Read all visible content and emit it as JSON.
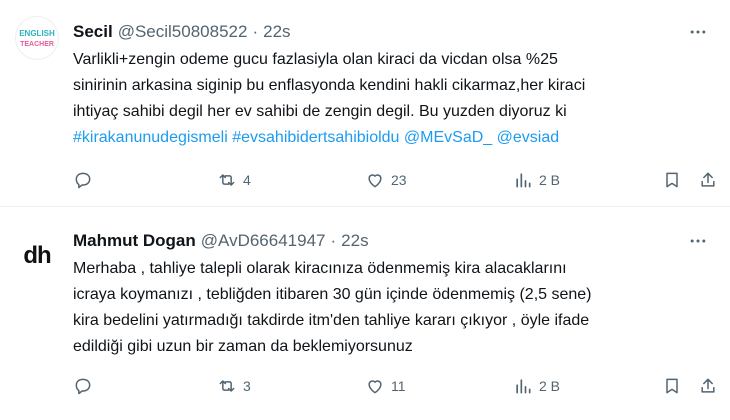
{
  "tweets": [
    {
      "author_name": "Secil",
      "handle": "@Secil50808522",
      "separator": "·",
      "time": "22s",
      "avatar_text_line1": "ENGLISH",
      "avatar_text_line2": "TEACHER",
      "text": "Varlikli+zengin odeme gucu fazlasiyla olan kiraci da vicdan olsa %25\nsinirinin arkasina siginip bu enflasyonda kendini hakli cikarmaz,her kiraci\nihtiyaç sahibi degil her ev sahibi de zengin degil. Bu yuzden diyoruz ki",
      "hashtags": [
        "#kirakanunudegismeli",
        "#evsahibidertsahibioldu",
        "@MEvSaD_",
        "@evsiad"
      ],
      "replies": "",
      "retweets": "4",
      "likes": "23",
      "views": "2 B"
    },
    {
      "author_name": "Mahmut Dogan",
      "handle": "@AvD66641947",
      "separator": "·",
      "time": "22s",
      "avatar_text": "dh",
      "text": "Merhaba , tahliye talepli olarak kiracınıza ödenmemiş kira alacaklarını\nicraya koymanızı , tebliğden itibaren 30 gün içinde ödenmemiş (2,5 sene)\nkira bedelini yatırmadığı takdirde itm'den tahliye kararı çıkıyor , öyle ifade\nedildiği gibi uzun bir zaman da beklemiyorsunuz",
      "replies": "",
      "retweets": "3",
      "likes": "11",
      "views": "2 B"
    }
  ],
  "colors": {
    "link": "#1d9bf0",
    "muted": "#536471",
    "text": "#0f1419"
  },
  "icons": [
    "reply-icon",
    "retweet-icon",
    "like-icon",
    "views-icon",
    "bookmark-icon",
    "share-icon",
    "more-icon"
  ]
}
